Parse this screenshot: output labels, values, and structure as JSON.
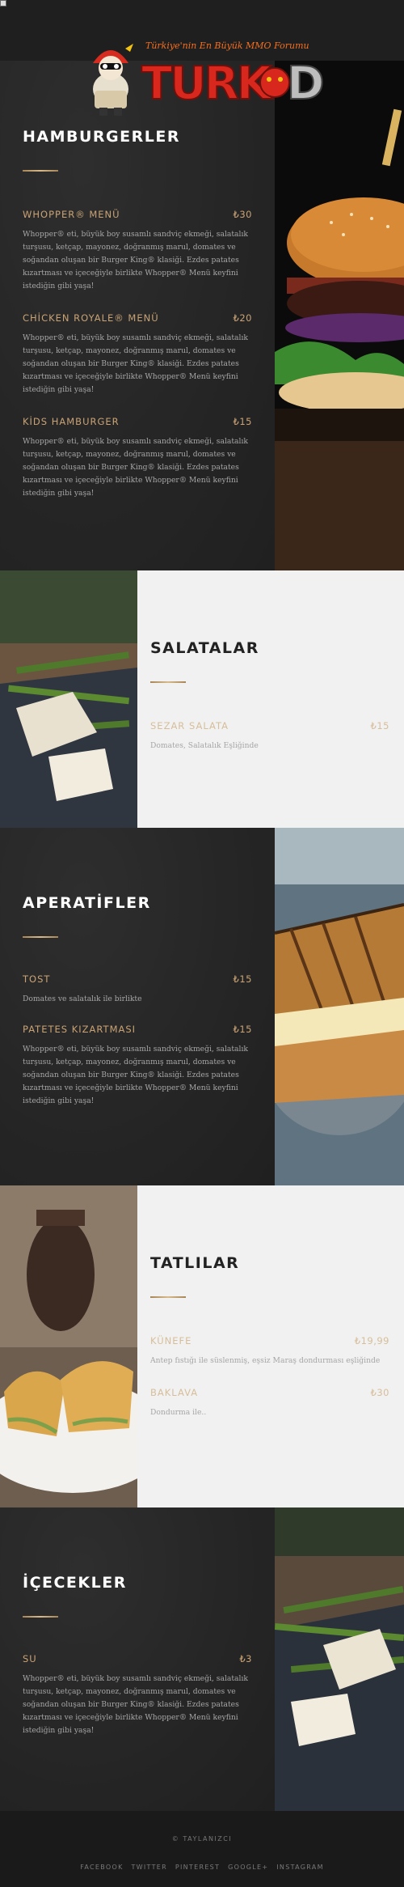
{
  "logo": {
    "tagline": "Türkiye'nin En Büyük MMO Forumu",
    "wordmark": "TURKMMO"
  },
  "sections": [
    {
      "title": "HAMBURGERLER",
      "items": [
        {
          "name": "WHOPPER® MENÜ",
          "price": "₺30",
          "desc": "Whopper® eti, büyük boy susamlı sandviç ekmeği, salatalık turşusu, ketçap, mayonez, doğranmış marul, domates ve soğandan oluşan bir Burger King® klasiği. Ezdes patates kızartması ve içeceğiyle birlikte Whopper® Menü keyfini istediğin gibi yaşa!"
        },
        {
          "name": "CHİCKEN ROYALE® MENÜ",
          "price": "₺20",
          "desc": "Whopper® eti, büyük boy susamlı sandviç ekmeği, salatalık turşusu, ketçap, mayonez, doğranmış marul, domates ve soğandan oluşan bir Burger King® klasiği. Ezdes patates kızartması ve içeceğiyle birlikte Whopper® Menü keyfini istediğin gibi yaşa!"
        },
        {
          "name": "KİDS HAMBURGER",
          "price": "₺15",
          "desc": "Whopper® eti, büyük boy susamlı sandviç ekmeği, salatalık turşusu, ketçap, mayonez, doğranmış marul, domates ve soğandan oluşan bir Burger King® klasiği. Ezdes patates kızartması ve içeceğiyle birlikte Whopper® Menü keyfini istediğin gibi yaşa!"
        }
      ]
    },
    {
      "title": "SALATALAR",
      "items": [
        {
          "name": "SEZAR SALATA",
          "price": "₺15",
          "desc": "Domates, Salatalık Eşliğinde"
        }
      ]
    },
    {
      "title": "APERATİFLER",
      "items": [
        {
          "name": "TOST",
          "price": "₺15",
          "desc": "Domates ve salatalık ile birlikte"
        },
        {
          "name": "PATETES KIZARTMASI",
          "price": "₺15",
          "desc": "Whopper® eti, büyük boy susamlı sandviç ekmeği, salatalık turşusu, ketçap, mayonez, doğranmış marul, domates ve soğandan oluşan bir Burger King® klasiği. Ezdes patates kızartması ve içeceğiyle birlikte Whopper® Menü keyfini istediğin gibi yaşa!"
        }
      ]
    },
    {
      "title": "TATLILAR",
      "items": [
        {
          "name": "KÜNEFE",
          "price": "₺19,99",
          "desc": "Antep fıstığı ile süslenmiş, eşsiz Maraş dondurması eşliğinde"
        },
        {
          "name": "BAKLAVA",
          "price": "₺30",
          "desc": "Dondurma ile.."
        }
      ]
    },
    {
      "title": "İÇECEKLER",
      "items": [
        {
          "name": "SU",
          "price": "₺3",
          "desc": "Whopper® eti, büyük boy susamlı sandviç ekmeği, salatalık turşusu, ketçap, mayonez, doğranmış marul, domates ve soğandan oluşan bir Burger King® klasiği. Ezdes patates kızartması ve içeceğiyle birlikte Whopper® Menü keyfini istediğin gibi yaşa!"
        }
      ]
    }
  ],
  "footer": {
    "copyright": "© TAYLANIZCI",
    "social": [
      "FACEBOOK",
      "TWITTER",
      "PINTEREST",
      "GOOGLE+",
      "INSTAGRAM"
    ]
  },
  "colors": {
    "accent": "#caa374",
    "dark_panel": "#262626",
    "light_panel": "#f1f1f1",
    "footer": "#1a1a1a"
  }
}
